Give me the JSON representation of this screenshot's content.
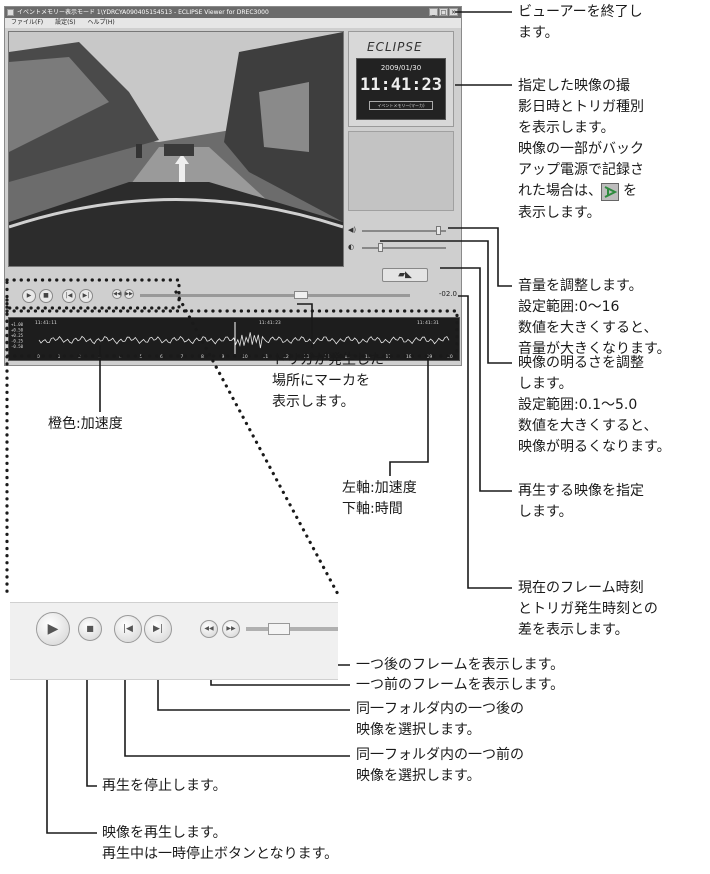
{
  "window": {
    "title": "イベントメモリー表示モード 1\\YDRCYA090405154513 - ECLIPSE Viewer for DREC3000",
    "menu": [
      "ファイル(F)",
      "設定(S)",
      "ヘルプ(H)"
    ],
    "logo": "ECLIPSE",
    "date": "2009/01/30",
    "time": "11:41:23",
    "trigger_label": "イベントメモリー(マーカ)",
    "time_diff": "-02.0",
    "graph_left_labels": [
      "+1.00",
      "+0.50",
      "+0.25",
      "-0.25",
      "-0.50"
    ],
    "graph_time_labels": [
      "11:41:11",
      "11:41:23",
      "11:41:31"
    ],
    "graph_x_ticks": [
      "0",
      "1",
      "2",
      "3",
      "4",
      "5",
      "6",
      "7",
      "8",
      "9",
      "10",
      "11",
      "12",
      "13",
      "14",
      "15",
      "16",
      "17",
      "18",
      "19",
      "20"
    ],
    "volume_level": 0.93,
    "brightness_level": 0.2,
    "progress_level": 0.6
  },
  "annotations": {
    "exit": "ビューアーを終了し\nます。",
    "datetime": "指定した映像の撮\n影日時とトリガ種別\nを表示します。\n映像の一部がバック\nアップ電源で記録さ\nれた場合は、",
    "datetime_tail1": "を",
    "datetime_tail2": "表示します。",
    "volume": "音量を調整します。\n設定範囲:0～16\n数値を大きくすると、\n音量が大きくなります。",
    "brightness": "映像の明るさを調整\nします。\n設定範囲:0.1～5.0\n数値を大きくすると、\n映像が明るくなります。",
    "select": "再生する映像を指定\nします。",
    "framediff": "現在のフレーム時刻\nとトリガ発生時刻との\n差を表示します。",
    "marker": "トリガが発生した\n場所にマーカを\n表示します。",
    "orange": "橙色:加速度",
    "axes": "左軸:加速度\n下軸:時間",
    "next_frame": "一つ後のフレームを表示します。",
    "prev_frame": "一つ前のフレームを表示します。",
    "next_video": "同一フォルダ内の一つ後の\n映像を選択します。",
    "prev_video": "同一フォルダ内の一つ前の\n映像を選択します。",
    "stop": "再生を停止します。",
    "play": "映像を再生します。\n再生中は一時停止ボタンとなります。"
  },
  "icons": {
    "play": "play-icon",
    "stop": "stop-icon",
    "prev_video": "skip-back-icon",
    "next_video": "skip-forward-icon",
    "prev_frame": "frame-back-icon",
    "next_frame": "frame-forward-icon",
    "volume": "speaker-icon",
    "brightness": "brightness-icon",
    "folder": "folder-open-icon",
    "backup": "backup-power-icon"
  },
  "colors": {
    "callout_line": "#1a1a1a",
    "graph_bg": "#1d1d1d",
    "graph_line": "#e8e8e8"
  }
}
